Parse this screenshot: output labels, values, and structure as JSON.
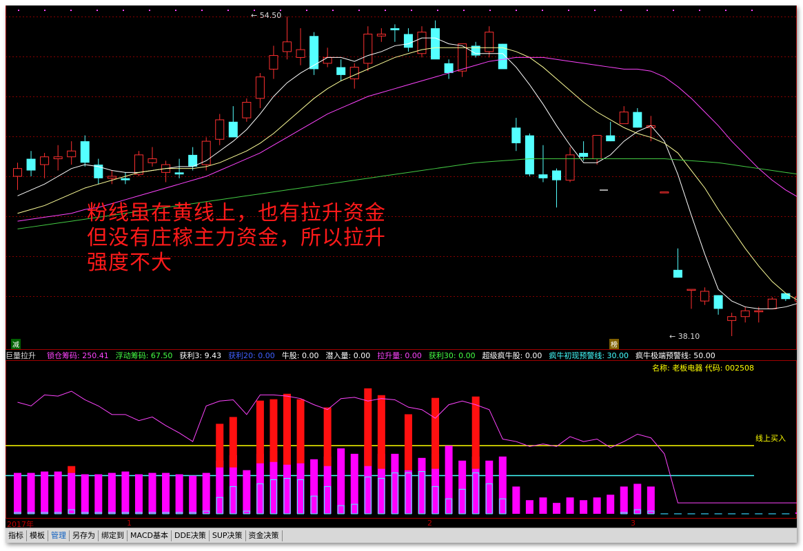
{
  "chart_data": {
    "type": "candlestick",
    "candles": [
      [
        46.3,
        47.0,
        45.6,
        46.7
      ],
      [
        47.2,
        47.6,
        46.3,
        46.6
      ],
      [
        46.9,
        47.5,
        46.2,
        47.3
      ],
      [
        47.2,
        47.9,
        46.6,
        47.3
      ],
      [
        47.3,
        48.1,
        46.9,
        47.6
      ],
      [
        48.1,
        48.4,
        46.8,
        47.0
      ],
      [
        46.9,
        47.2,
        45.9,
        46.2
      ],
      [
        46.2,
        46.6,
        45.9,
        46.3
      ],
      [
        46.2,
        46.5,
        45.9,
        46.1
      ],
      [
        46.4,
        47.6,
        46.3,
        47.4
      ],
      [
        47.0,
        47.8,
        46.8,
        47.2
      ],
      [
        46.5,
        47.1,
        46.0,
        46.9
      ],
      [
        46.5,
        47.2,
        46.2,
        46.4
      ],
      [
        47.4,
        47.8,
        46.6,
        46.8
      ],
      [
        46.9,
        48.3,
        46.6,
        48.1
      ],
      [
        48.2,
        49.5,
        47.9,
        49.2
      ],
      [
        49.1,
        49.9,
        48.5,
        48.3
      ],
      [
        49.3,
        50.3,
        49.1,
        50.1
      ],
      [
        50.3,
        51.6,
        49.8,
        51.4
      ],
      [
        51.8,
        53.0,
        51.3,
        52.5
      ],
      [
        52.7,
        54.5,
        52.3,
        53.2
      ],
      [
        52.4,
        53.9,
        52.0,
        52.8
      ],
      [
        53.5,
        53.7,
        51.5,
        51.8
      ],
      [
        52.1,
        52.9,
        51.9,
        52.4
      ],
      [
        51.9,
        52.3,
        51.2,
        51.5
      ],
      [
        51.3,
        52.1,
        50.8,
        51.9
      ],
      [
        52.1,
        54.0,
        51.7,
        53.6
      ],
      [
        53.5,
        53.9,
        53.2,
        53.6
      ],
      [
        53.9,
        54.1,
        53.2,
        53.8
      ],
      [
        53.6,
        53.9,
        52.7,
        52.9
      ],
      [
        52.6,
        54.0,
        52.4,
        53.7
      ],
      [
        53.9,
        54.3,
        52.4,
        52.3
      ],
      [
        52.1,
        52.3,
        51.3,
        51.6
      ],
      [
        51.7,
        53.0,
        51.4,
        53.1
      ],
      [
        53.0,
        53.2,
        52.4,
        52.5
      ],
      [
        52.7,
        54.0,
        52.4,
        53.7
      ],
      [
        53.1,
        53.1,
        52.3,
        51.8
      ],
      [
        48.8,
        49.3,
        47.6,
        48.0
      ],
      [
        48.4,
        48.5,
        46.3,
        46.4
      ],
      [
        46.4,
        47.9,
        46.0,
        46.2
      ],
      [
        46.6,
        46.7,
        44.7,
        46.1
      ],
      [
        46.1,
        47.8,
        46.0,
        47.4
      ],
      [
        47.5,
        48.1,
        47.1,
        47.3
      ],
      [
        47.2,
        48.4,
        46.9,
        48.4
      ],
      [
        48.4,
        49.1,
        48.1,
        48.1
      ],
      [
        49.0,
        49.9,
        49.0,
        49.6
      ],
      [
        49.6,
        49.8,
        48.8,
        48.8
      ],
      [
        48.8,
        49.4,
        48.1,
        48.9
      ],
      [
        45.5,
        45.5,
        45.5,
        45.5
      ],
      [
        41.5,
        42.6,
        41.1,
        41.1
      ],
      [
        40.5,
        40.5,
        39.5,
        40.5
      ],
      [
        39.9,
        40.6,
        39.7,
        40.4
      ],
      [
        40.2,
        40.2,
        39.2,
        39.5
      ],
      [
        38.9,
        39.3,
        38.1,
        39.1
      ],
      [
        39.1,
        39.6,
        38.8,
        39.4
      ],
      [
        39.4,
        39.6,
        38.8,
        39.4
      ],
      [
        39.5,
        40.1,
        39.5,
        40.0
      ],
      [
        40.3,
        40.3,
        39.9,
        40.0
      ],
      [
        39.9,
        40.2,
        39.7,
        40.1
      ],
      [
        40.1,
        40.9,
        40.0,
        40.6
      ]
    ],
    "price_range": [
      38.1,
      54.5
    ],
    "high_label": "54.50",
    "low_label": "38.10",
    "ma_series": [
      {
        "name": "MA5",
        "color": "#ffffff",
        "values": [
          45.3,
          45.6,
          45.9,
          46.3,
          46.7,
          46.9,
          46.8,
          46.6,
          46.5,
          46.5,
          46.6,
          46.7,
          46.8,
          46.8,
          47.1,
          47.6,
          48.1,
          48.7,
          49.5,
          50.4,
          51.1,
          51.6,
          52.0,
          52.4,
          52.4,
          52.2,
          52.5,
          52.7,
          53.0,
          53.1,
          53.4,
          53.4,
          53.1,
          53.0,
          52.6,
          52.6,
          52.6,
          51.9,
          51.0,
          50.0,
          48.9,
          47.9,
          47.0,
          47.0,
          47.4,
          48.1,
          48.6,
          48.9,
          48.1,
          46.4,
          44.3,
          42.3,
          40.5,
          39.9,
          39.6,
          39.5,
          39.5,
          39.6,
          39.8,
          40.0
        ]
      },
      {
        "name": "MA10",
        "color": "#ffff99",
        "values": [
          44.4,
          44.6,
          44.8,
          45.1,
          45.4,
          45.7,
          45.9,
          46.1,
          46.3,
          46.5,
          46.6,
          46.7,
          46.7,
          46.7,
          46.8,
          47.0,
          47.3,
          47.6,
          48.0,
          48.5,
          49.1,
          49.7,
          50.3,
          50.8,
          51.2,
          51.5,
          51.8,
          52.1,
          52.4,
          52.6,
          52.8,
          52.9,
          52.9,
          52.9,
          52.9,
          52.9,
          52.9,
          52.7,
          52.4,
          51.9,
          51.3,
          50.7,
          50.1,
          49.6,
          49.2,
          48.8,
          48.5,
          48.3,
          48.0,
          47.5,
          46.6,
          45.7,
          44.6,
          43.6,
          42.6,
          41.7,
          40.9,
          40.3,
          39.9,
          39.8
        ]
      },
      {
        "name": "MA30",
        "color": "#ff44ff",
        "values": [
          44.0,
          44.1,
          44.2,
          44.3,
          44.4,
          44.6,
          44.7,
          44.9,
          45.1,
          45.3,
          45.5,
          45.7,
          45.9,
          46.1,
          46.3,
          46.6,
          46.9,
          47.2,
          47.5,
          47.9,
          48.3,
          48.7,
          49.1,
          49.5,
          49.8,
          50.1,
          50.4,
          50.6,
          50.8,
          51.0,
          51.2,
          51.4,
          51.6,
          51.8,
          52.0,
          52.2,
          52.3,
          52.4,
          52.4,
          52.4,
          52.3,
          52.2,
          52.1,
          52.0,
          51.9,
          51.8,
          51.8,
          51.7,
          51.4,
          50.9,
          50.3,
          49.6,
          48.9,
          48.1,
          47.4,
          46.7,
          46.1,
          45.6,
          45.2,
          44.9
        ]
      },
      {
        "name": "MA120",
        "color": "#44cc44",
        "values": [
          43.6,
          43.7,
          43.8,
          43.9,
          44.0,
          44.1,
          44.2,
          44.3,
          44.4,
          44.5,
          44.6,
          44.7,
          44.8,
          44.9,
          45.0,
          45.1,
          45.2,
          45.3,
          45.4,
          45.5,
          45.6,
          45.7,
          45.8,
          45.9,
          46.0,
          46.1,
          46.2,
          46.3,
          46.4,
          46.5,
          46.6,
          46.7,
          46.8,
          46.9,
          47.0,
          47.05,
          47.1,
          47.15,
          47.2,
          47.2,
          47.2,
          47.2,
          47.2,
          47.2,
          47.2,
          47.2,
          47.2,
          47.2,
          47.2,
          47.15,
          47.1,
          47.05,
          47.0,
          46.9,
          46.8,
          46.7,
          46.6,
          46.5,
          46.4,
          46.3
        ]
      }
    ],
    "indicator": {
      "title": "巨量拉升",
      "outer": [
        30,
        30,
        31,
        31,
        30,
        29,
        29,
        30,
        31,
        29,
        30,
        30,
        29,
        28,
        30,
        39,
        43,
        32,
        44,
        46,
        49,
        47,
        40,
        42,
        48,
        44,
        49,
        44,
        44,
        32,
        41,
        44,
        50,
        39,
        42,
        39,
        42,
        20,
        10,
        12,
        8,
        12,
        10,
        12,
        14,
        20,
        22,
        20,
        0,
        0,
        0,
        0,
        0,
        0,
        0,
        0,
        0,
        0,
        1,
        1
      ],
      "middle": [
        0,
        0,
        0,
        0,
        0,
        0,
        0,
        0,
        0,
        0,
        0,
        0,
        0,
        0,
        0,
        34,
        34,
        0,
        37,
        38,
        36,
        37,
        0,
        35,
        0,
        0,
        35,
        33,
        0,
        0,
        0,
        33,
        0,
        0,
        33,
        30,
        0,
        0,
        0,
        0,
        0,
        0,
        0,
        0,
        0,
        0,
        0,
        0,
        0,
        0,
        0,
        0,
        0,
        0,
        0,
        0,
        0,
        0,
        0,
        0
      ],
      "red": [
        0,
        0,
        0,
        0,
        35,
        0,
        0,
        0,
        0,
        0,
        0,
        0,
        0,
        0,
        0,
        66,
        71,
        0,
        83,
        84,
        88,
        84,
        0,
        78,
        0,
        0,
        92,
        87,
        0,
        73,
        0,
        85,
        0,
        0,
        86,
        0,
        0,
        0,
        0,
        0,
        0,
        0,
        0,
        0,
        0,
        0,
        0,
        0,
        0,
        0,
        0,
        0,
        0,
        0,
        0,
        0,
        0,
        0,
        0,
        0
      ],
      "cyan_top": [
        1,
        1,
        1,
        1,
        3,
        1,
        1,
        1,
        1,
        1,
        1,
        1,
        1,
        1,
        2,
        12,
        20,
        2,
        22,
        25,
        26,
        25,
        13,
        20,
        6,
        7,
        27,
        26,
        30,
        30,
        31,
        20,
        11,
        18,
        30,
        22,
        11,
        0,
        0,
        0,
        0,
        0,
        0,
        0,
        0,
        1,
        3,
        2,
        0,
        0,
        0,
        0,
        0,
        0,
        0,
        0,
        0,
        0,
        0,
        0
      ],
      "line": [
        82,
        79,
        88,
        87,
        91,
        84,
        79,
        72,
        72,
        67,
        70,
        63,
        57,
        50,
        79,
        83,
        84,
        72,
        88,
        88,
        87,
        85,
        80,
        76,
        85,
        86,
        83,
        85,
        84,
        78,
        76,
        69,
        80,
        83,
        80,
        76,
        52,
        50,
        46,
        48,
        46,
        54,
        50,
        52,
        45,
        50,
        56,
        53,
        40,
        0,
        0,
        0,
        0,
        0,
        0,
        0,
        0,
        0,
        0,
        5
      ],
      "yellow_level": 50,
      "cyan_level": 28,
      "ymax": 100
    }
  },
  "annotation": {
    "line1": "粉线虽在黄线上，也有拉升资金",
    "line2": "但没有庄稼主力资金，所以拉升",
    "line3": "强度不大"
  },
  "indicator_bar": {
    "title": "巨量拉升",
    "items": [
      {
        "label": "锁仓筹码: 250.41",
        "color": "#ff44ff"
      },
      {
        "label": "浮动筹码: 67.50",
        "color": "#44ff44"
      },
      {
        "label": "获利3: 9.43",
        "color": "#ffffff"
      },
      {
        "label": "获利20: 0.00",
        "color": "#4060ff"
      },
      {
        "label": "牛股: 0.00",
        "color": "#ffffff"
      },
      {
        "label": "潜入量: 0.00",
        "color": "#ffffff"
      },
      {
        "label": "拉升量: 0.00",
        "color": "#ff44ff"
      },
      {
        "label": "获利30: 0.00",
        "color": "#44ff44"
      },
      {
        "label": "超级疯牛股: 0.00",
        "color": "#ffffff"
      },
      {
        "label": "疯牛初现预警线: 30.00",
        "color": "#44ffff"
      },
      {
        "label": "疯牛极端预警线: 50.00",
        "color": "#ffffff"
      }
    ]
  },
  "stock_info": "名称: 老板电器 代码: 002508",
  "buy_line_label": "线上买入",
  "flags": {
    "left": "减",
    "right": "榜"
  },
  "x_axis": {
    "labels": [
      "2017年",
      "1",
      "2",
      "3"
    ]
  },
  "toolbar": {
    "items": [
      "指标",
      "模板",
      "管理",
      "另存为",
      "绑定到",
      "MACD基本",
      "DDE决策",
      "SUP决策",
      "资金决策"
    ],
    "active": "管理"
  },
  "colors": {
    "up": "#ff3030",
    "down": "#54ffff",
    "background": "#000000",
    "grid": "#8b0000"
  }
}
